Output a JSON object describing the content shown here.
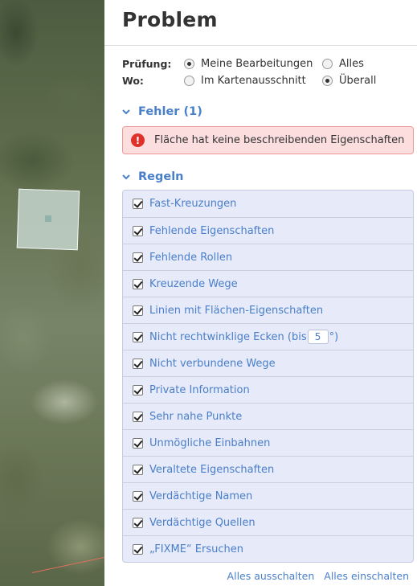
{
  "panel": {
    "title": "Problem"
  },
  "options": {
    "check": {
      "label": "Prüfung:",
      "choices": [
        {
          "label": "Meine Bearbeitungen",
          "checked": true
        },
        {
          "label": "Alles",
          "checked": false
        }
      ]
    },
    "where": {
      "label": "Wo:",
      "choices": [
        {
          "label": "Im Kartenausschnitt",
          "checked": false
        },
        {
          "label": "Überall",
          "checked": true
        }
      ]
    }
  },
  "errors": {
    "heading": "Fehler (1)",
    "items": [
      {
        "icon": "error-icon",
        "text": "Fläche hat keine beschreibenden Eigenschaften"
      }
    ]
  },
  "rules": {
    "heading": "Regeln",
    "items": [
      {
        "label": "Fast-Kreuzungen",
        "checked": true
      },
      {
        "label": "Fehlende Eigenschaften",
        "checked": true
      },
      {
        "label": "Fehlende Rollen",
        "checked": true
      },
      {
        "label": "Kreuzende Wege",
        "checked": true
      },
      {
        "label": "Linien mit Flächen-Eigenschaften",
        "checked": true
      },
      {
        "label_prefix": "Nicht rechtwinklige Ecken (bis",
        "value": "5",
        "label_suffix": "°)",
        "checked": true
      },
      {
        "label": "Nicht verbundene Wege",
        "checked": true
      },
      {
        "label": "Private Information",
        "checked": true
      },
      {
        "label": "Sehr nahe Punkte",
        "checked": true
      },
      {
        "label": "Unmögliche Einbahnen",
        "checked": true
      },
      {
        "label": "Veraltete Eigenschaften",
        "checked": true
      },
      {
        "label": "Verdächtige Namen",
        "checked": true
      },
      {
        "label": "Verdächtige Quellen",
        "checked": true
      },
      {
        "label": "„FIXME“ Ersuchen",
        "checked": true
      }
    ],
    "disable_all": "Alles ausschalten",
    "enable_all": "Alles einschalten"
  },
  "colors": {
    "accent": "#4a7fc9",
    "error_bg": "#fcdede",
    "error_icon": "#e0302a",
    "rules_bg": "#e6eaf9"
  }
}
